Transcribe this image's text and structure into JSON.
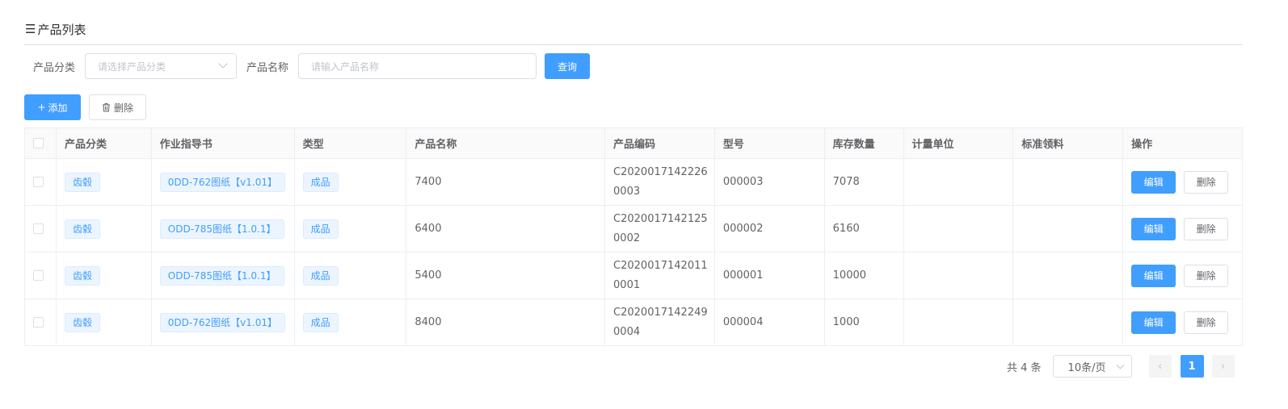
{
  "page": {
    "title": "产品列表"
  },
  "filter": {
    "category_label": "产品分类",
    "category_placeholder": "请选择产品分类",
    "name_label": "产品名称",
    "name_placeholder": "请输入产品名称",
    "query_label": "查询"
  },
  "toolbar": {
    "add_label": "添加",
    "delete_label": "删除"
  },
  "table": {
    "headers": [
      "产品分类",
      "作业指导书",
      "类型",
      "产品名称",
      "产品编码",
      "型号",
      "库存数量",
      "计量单位",
      "标准领料",
      "操作"
    ],
    "rows": [
      {
        "category": "齿毂",
        "instruction": "0DD-762图纸【v1.01】",
        "type": "成品",
        "name": "7400",
        "code": "C20200171422260003",
        "model": "000003",
        "stock": "7078",
        "unit": "",
        "standard": "",
        "edit": "编辑",
        "delete": "删除"
      },
      {
        "category": "齿毂",
        "instruction": "ODD-785图纸【1.0.1】",
        "type": "成品",
        "name": "6400",
        "code": "C20200171421250002",
        "model": "000002",
        "stock": "6160",
        "unit": "",
        "standard": "",
        "edit": "编辑",
        "delete": "删除"
      },
      {
        "category": "齿毂",
        "instruction": "ODD-785图纸【1.0.1】",
        "type": "成品",
        "name": "5400",
        "code": "C20200171420110001",
        "model": "000001",
        "stock": "10000",
        "unit": "",
        "standard": "",
        "edit": "编辑",
        "delete": "删除"
      },
      {
        "category": "齿毂",
        "instruction": "0DD-762图纸【v1.01】",
        "type": "成品",
        "name": "8400",
        "code": "C20200171422490004",
        "model": "000004",
        "stock": "1000",
        "unit": "",
        "standard": "",
        "edit": "编辑",
        "delete": "删除"
      }
    ]
  },
  "pagination": {
    "total": "共 4 条",
    "page_size": "10条/页",
    "current_page": "1",
    "prev_icon": "‹",
    "next_icon": "›"
  },
  "colors": {
    "primary": "#409eff",
    "border": "#dcdfe6",
    "tag_bg": "#ecf5ff"
  }
}
